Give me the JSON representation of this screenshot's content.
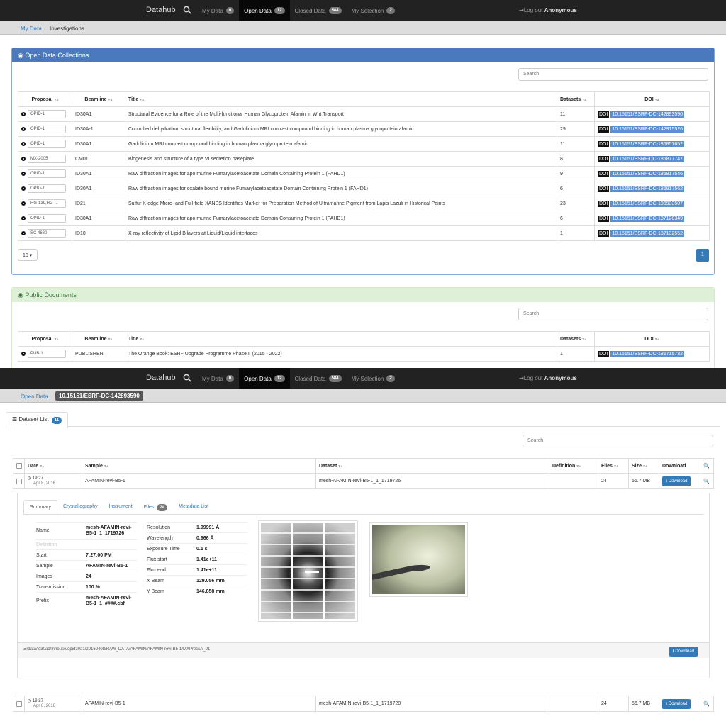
{
  "nav": {
    "brand": "Datahub",
    "items": [
      {
        "label": "My Data",
        "badge": "0"
      },
      {
        "label": "Open Data",
        "badge": "12"
      },
      {
        "label": "Closed Data",
        "badge": "584"
      },
      {
        "label": "My Selection",
        "badge": "2"
      }
    ],
    "logout_prefix": "Log out",
    "logout_user": "Anonymous"
  },
  "top": {
    "breadcrumb": [
      "My Data",
      "Investigations"
    ],
    "collections_title": "Open Data Collections",
    "search_placeholder": "Search",
    "columns": [
      "Proposal",
      "Beamline",
      "Title",
      "Datasets",
      "DOI"
    ],
    "doi_tag": "DOI",
    "rows": [
      {
        "proposal": "OPID-1",
        "beamline": "ID30A1",
        "title": "Structural Evidence for a Role of the Multi-functional Human Glycoprotein Afamin in Wnt Transport",
        "datasets": "11",
        "doi": "10.15151/ESRF-DC-142893590"
      },
      {
        "proposal": "OPID-1",
        "beamline": "ID30A-1",
        "title": "Controlled dehydration, structural flexibility, and Gadolinium MRI contrast compound binding in human plasma glycoprotein afamin",
        "datasets": "29",
        "doi": "10.15151/ESRF-DC-142915526"
      },
      {
        "proposal": "OPID-1",
        "beamline": "ID30A1",
        "title": "Gadolinium MRI contrast compound binding in human plasma glycoprotein afamin",
        "datasets": "11",
        "doi": "10.15151/ESRF-DC-186857652"
      },
      {
        "proposal": "MX-2005",
        "beamline": "CM01",
        "title": "Biogenesis and structure of a type VI secretion baseplate",
        "datasets": "8",
        "doi": "10.15151/ESRF-DC-186877747"
      },
      {
        "proposal": "OPID-1",
        "beamline": "ID30A1",
        "title": "Raw diffraction images for apo murine Fumarylacetoacetate Domain Containing Protein 1 (FAHD1)",
        "datasets": "9",
        "doi": "10.15151/ESRF-DC-186917546"
      },
      {
        "proposal": "OPID-1",
        "beamline": "ID30A1",
        "title": "Raw diffraction images for oxalate bound murine Fumarylacetoacetate Domain Containing Protein 1 (FAHD1)",
        "datasets": "6",
        "doi": "10.15151/ESRF-DC-186917562"
      },
      {
        "proposal": "HG-139,HG-...",
        "beamline": "ID21",
        "title": "Sulfur K-edge Micro- and Full-field XANES Identifies Marker for Preparation Method of Ultramarine Pigment from Lapis Lazuli in Historical Paints",
        "datasets": "23",
        "doi": "10.15151/ESRF-DC-186933507"
      },
      {
        "proposal": "OPID-1",
        "beamline": "ID30A1",
        "title": "Raw diffraction images for apo murine Fumarylacetoacetate Domain Containing Protein 1 (FAHD1)",
        "datasets": "6",
        "doi": "10.15151/ESRF-DC-187128349"
      },
      {
        "proposal": "SC 4680",
        "beamline": "ID10",
        "title": "X-ray reflectivity of Lipid Bilayers at Liquid/Liquid interfaces",
        "datasets": "1",
        "doi": "10.15151/ESRF-DC-187132552"
      }
    ],
    "page_size": "10",
    "page": "1",
    "docs_title": "Public Documents",
    "doc_rows": [
      {
        "proposal": "PUB-1",
        "beamline": "PUBLISHER",
        "title": "The Orange Book: ESRF Upgrade Programme Phase II (2015 - 2022)",
        "datasets": "1",
        "doi": "10.15151/ESRF-DC-186715732"
      }
    ]
  },
  "bottom": {
    "breadcrumb_link": "Open Data",
    "breadcrumb_current": "10.15151/ESRF-DC-142893590",
    "tab_label": "Dataset List",
    "tab_badge": "11",
    "search_placeholder": "Search",
    "columns": [
      "Date",
      "Sample",
      "Dataset",
      "Definition",
      "Files",
      "Size",
      "Download"
    ],
    "rows": [
      {
        "time": "19:27",
        "date": "Apr 8, 2016",
        "sample": "AFAMIN-revi-B5-1",
        "dataset": "mesh-AFAMIN-revi-B5-1_1_1719726",
        "files": "24",
        "size": "56.7 MB",
        "download": "Download"
      },
      {
        "time": "19:27",
        "date": "Apr 8, 2016",
        "sample": "AFAMIN-revi-B5-1",
        "dataset": "mesh-AFAMIN-revi-B5-1_1_1719728",
        "files": "24",
        "size": "56.7 MB",
        "download": "Download"
      }
    ],
    "subtabs": [
      {
        "label": "Summary"
      },
      {
        "label": "Crystallography"
      },
      {
        "label": "Instrument"
      },
      {
        "label": "Files",
        "badge": "24"
      },
      {
        "label": "Metadata List"
      }
    ],
    "summary_left": [
      {
        "k": "Name",
        "v": "mesh-AFAMIN-revi-B5-1_1_1719726"
      },
      {
        "k": "Definition",
        "v": ""
      },
      {
        "k": "Start",
        "v": "7:27:00 PM"
      },
      {
        "k": "Sample",
        "v": "AFAMIN-revi-B5-1"
      },
      {
        "k": "Images",
        "v": "24"
      },
      {
        "k": "Transmission",
        "v": "100 %"
      },
      {
        "k": "Prefix",
        "v": "mesh-AFAMIN-revi-B5-1_1_####.cbf"
      }
    ],
    "summary_right": [
      {
        "k": "Resolution",
        "v": "1.99991 Å"
      },
      {
        "k": "Wavelength",
        "v": "0.966 Å"
      },
      {
        "k": "Exposure Time",
        "v": "0.1 s"
      },
      {
        "k": "Flux start",
        "v": "1.41e+11"
      },
      {
        "k": "Flux end",
        "v": "1.41e+11"
      },
      {
        "k": "X Beam",
        "v": "129.056 mm"
      },
      {
        "k": "Y Beam",
        "v": "146.858 mm"
      }
    ],
    "path": "/data/id30a1/inhouse/opid30a1/20160408/RAW_DATA/AFAMIN/AFAMIN-revi-B5-1/MXPressA_01",
    "path_download": "Download"
  }
}
